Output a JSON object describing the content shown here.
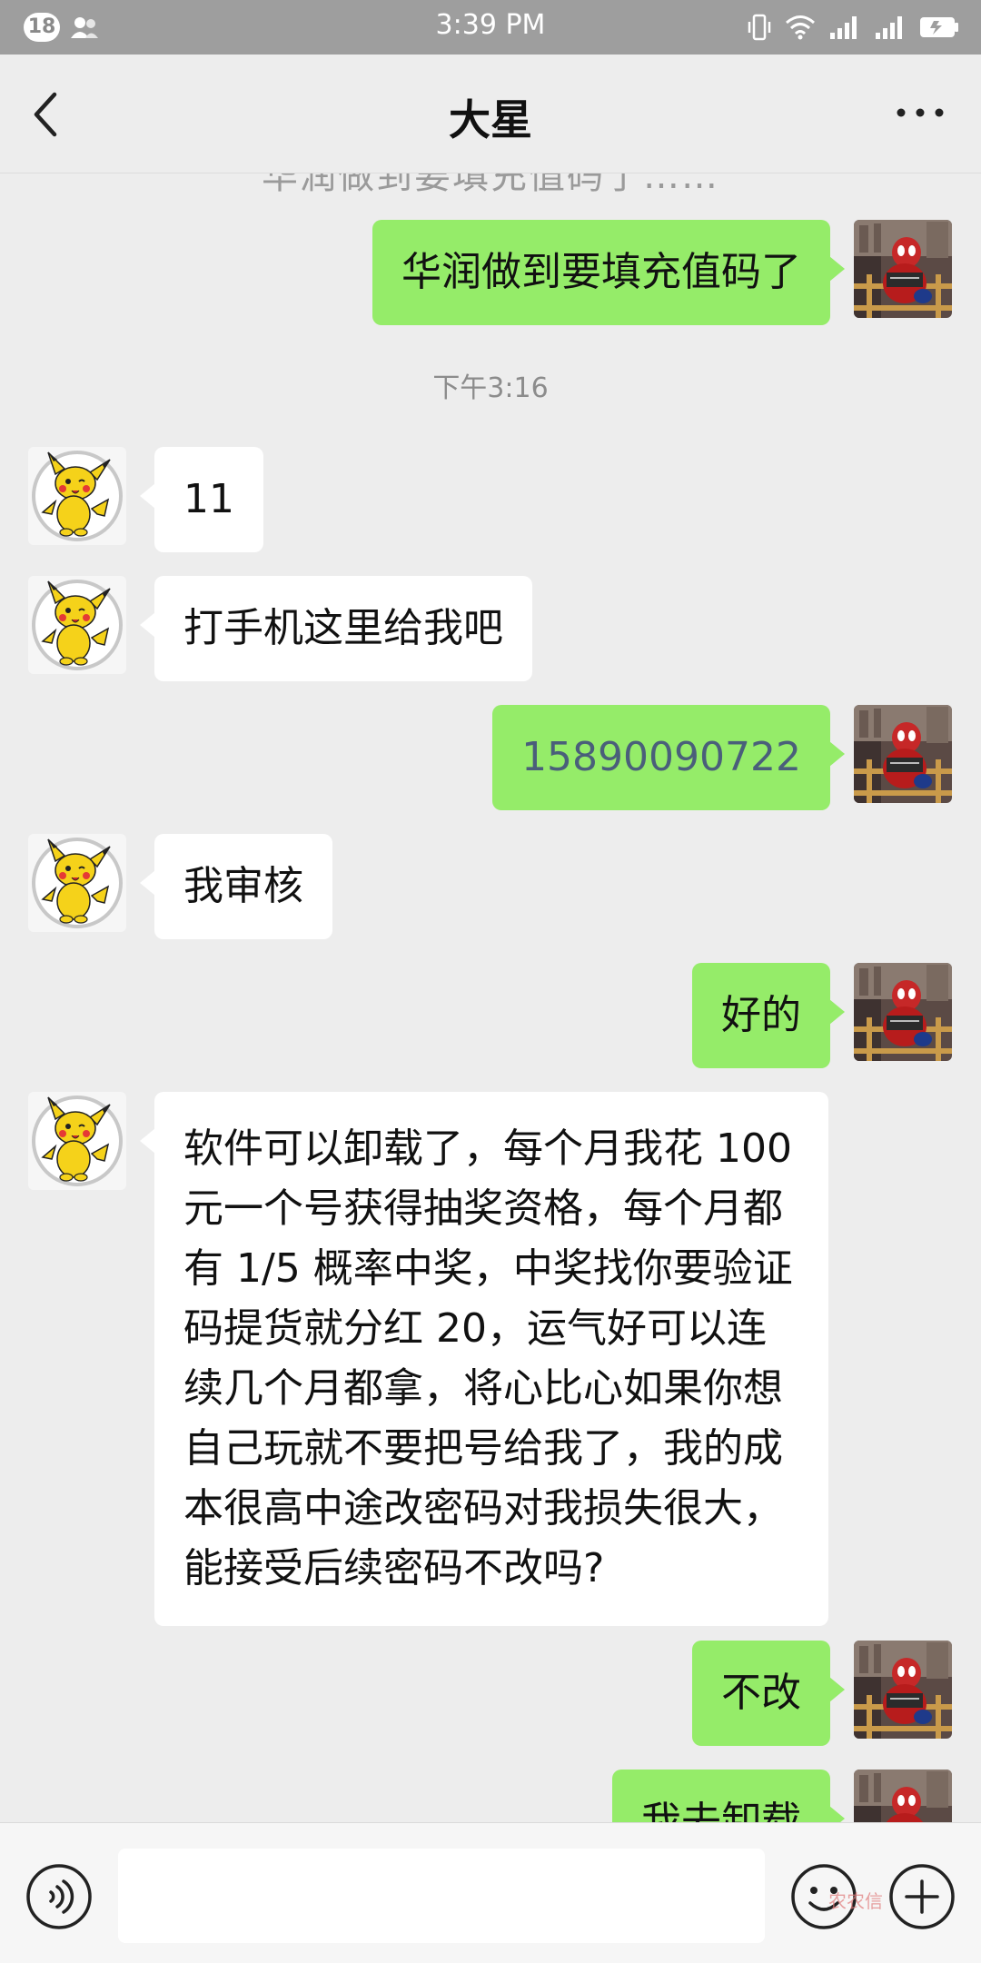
{
  "status_bar": {
    "notification_count": "18",
    "time": "3:39 PM"
  },
  "header": {
    "title": "大星"
  },
  "messages": [
    {
      "id": "m0",
      "direction": "in",
      "text": "华润做到要填充值码了……"
    },
    {
      "id": "m1",
      "direction": "out",
      "text": "华润做到要填充值码了"
    },
    {
      "id": "ts1",
      "type": "timestamp",
      "text": "下午3:16"
    },
    {
      "id": "m2",
      "direction": "in",
      "text": "11"
    },
    {
      "id": "m3",
      "direction": "in",
      "text": "打手机这里给我吧"
    },
    {
      "id": "m4",
      "direction": "out",
      "text": "15890090722"
    },
    {
      "id": "m5",
      "direction": "in",
      "text": "我审核"
    },
    {
      "id": "m6",
      "direction": "out",
      "text": "好的"
    },
    {
      "id": "m7",
      "direction": "in",
      "text": "软件可以卸载了，每个月我花 100 元一个号获得抽奖资格，每个月都有 1/5 概率中奖，中奖找你要验证码提货就分红 20，运气好可以连续几个月都拿，将心比心如果你想自己玩就不要把号给我了，我的成本很高中途改密码对我损失很大，能接受后续密码不改吗?"
    },
    {
      "id": "m8",
      "direction": "out",
      "text": "不改"
    },
    {
      "id": "m9",
      "direction": "out",
      "text": "我去卸载"
    }
  ],
  "input_bar": {
    "placeholder": "",
    "watermark": "农农信"
  },
  "icons": {
    "back": "back-arrow-icon",
    "more": "more-dots-icon",
    "voice": "voice-icon",
    "emoji": "emoji-icon",
    "plus": "plus-icon"
  },
  "colors": {
    "outgoing_bubble": "#95ec69",
    "incoming_bubble": "#ffffff",
    "background": "#ededed",
    "phone_link": "#4a5f7a"
  }
}
